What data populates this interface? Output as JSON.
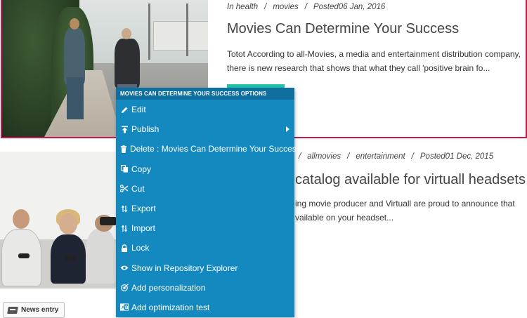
{
  "articles": [
    {
      "meta": {
        "prefix": "In health",
        "sep": "/",
        "category": "movies",
        "posted": "Posted06 Jan, 2016"
      },
      "title": "Movies Can Determine Your Success",
      "excerpt": "Totot According to all-Movies, a media and entertainment distribution company, there is new research that shows that what they call 'positive brain fo..."
    },
    {
      "meta": {
        "sep": "/",
        "category1": "allmovies",
        "category2": "entertainment",
        "posted": "Posted01 Dec, 2015"
      },
      "title_visible": "catalog available for virtuall headsets !",
      "excerpt_line1": "ing movie producer and Virtuall are proud to announce that",
      "excerpt_line2": "vailable on your headset..."
    }
  ],
  "news_entry": {
    "label": "News entry"
  },
  "context_menu": {
    "header": "MOVIES CAN DETERMINE YOUR SUCCESS OPTIONS",
    "items": [
      {
        "label": "Edit",
        "icon": "pencil-icon"
      },
      {
        "label": "Publish",
        "icon": "publish-icon",
        "submenu": true
      },
      {
        "label": "Delete : Movies Can Determine Your Success",
        "icon": "trash-icon"
      },
      {
        "label": "Copy",
        "icon": "copy-icon"
      },
      {
        "label": "Cut",
        "icon": "scissors-icon"
      },
      {
        "label": "Export",
        "icon": "export-arrows-icon"
      },
      {
        "label": "Import",
        "icon": "import-arrows-icon"
      },
      {
        "label": "Lock",
        "icon": "lock-icon"
      },
      {
        "label": "Show in Repository Explorer",
        "icon": "eye-icon"
      },
      {
        "label": "Add personalization",
        "icon": "target-icon"
      },
      {
        "label": "Add optimization test",
        "icon": "ab-test-icon"
      }
    ]
  },
  "colors": {
    "selection_border": "#c8174b",
    "menu_bg": "#1489c0",
    "menu_header_bg": "#0f6f9e",
    "accent_teal": "#1fc4a8"
  }
}
